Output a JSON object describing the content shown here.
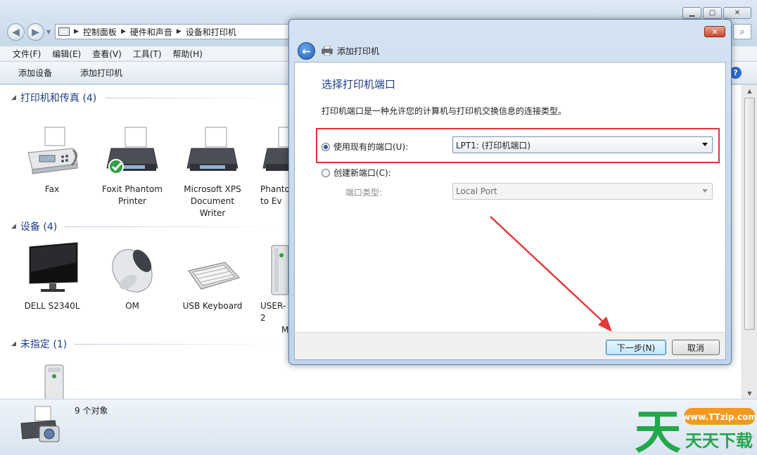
{
  "explorer": {
    "address": {
      "crumbs": [
        "控制面板",
        "硬件和声音",
        "设备和打印机"
      ]
    },
    "menu": [
      "文件(F)",
      "编辑(E)",
      "查看(V)",
      "工具(T)",
      "帮助(H)"
    ],
    "toolbar": {
      "add_device": "添加设备",
      "add_printer": "添加打印机"
    },
    "groups": {
      "printers": {
        "title": "打印机和传真 (4)",
        "items": [
          {
            "line1": "Fax",
            "line2": "",
            "line3": ""
          },
          {
            "line1": "Foxit Phantom",
            "line2": "Printer",
            "line3": ""
          },
          {
            "line1": "Microsoft XPS",
            "line2": "Document",
            "line3": "Writer"
          },
          {
            "line1": "Phanto",
            "line2": "to Ev",
            "line3": ""
          }
        ]
      },
      "devices": {
        "title": "设备 (4)",
        "items": [
          {
            "line1": "DELL S2340L",
            "line2": ""
          },
          {
            "line1": "OM",
            "line2": ""
          },
          {
            "line1": "USB Keyboard",
            "line2": ""
          },
          {
            "line1": "USER-2",
            "line2": "M"
          }
        ]
      },
      "unspecified": {
        "title": "未指定 (1)"
      }
    },
    "status": {
      "text": "9 个对象"
    }
  },
  "dialog": {
    "close_label": "✕",
    "title": "添加打印机",
    "heading": "选择打印机端口",
    "description": "打印机端口是一种允许您的计算机与打印机交换信息的连接类型。",
    "use_existing": {
      "label": "使用现有的端口(U):",
      "checked": true,
      "selected_value": "LPT1: (打印机端口)"
    },
    "create_new": {
      "label": "创建新端口(C):",
      "checked": false,
      "port_type_label": "端口类型:",
      "port_type_value": "Local Port"
    },
    "buttons": {
      "next": "下一步(N)",
      "cancel": "取消"
    }
  },
  "watermark": {
    "site": "www.TTzip.com",
    "text": "天天下载",
    "big_char": "天"
  },
  "colors": {
    "highlight_red": "#e0343a",
    "heading_blue": "#1b3b8c",
    "watermark_green": "#21a84a",
    "watermark_orange": "#f29a1f"
  }
}
